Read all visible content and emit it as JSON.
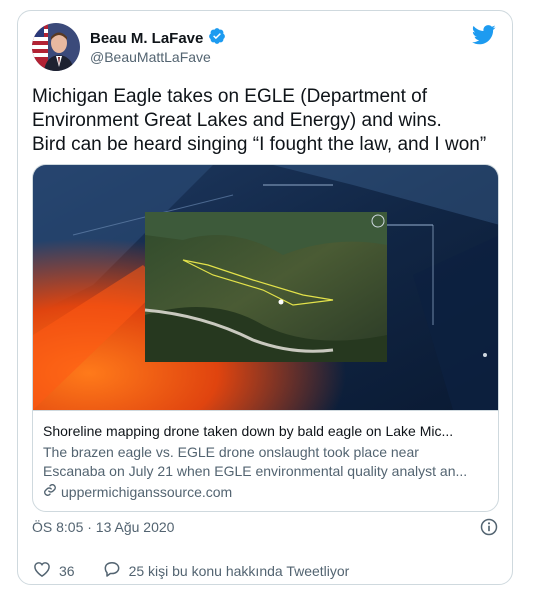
{
  "author": {
    "name": "Beau M. LaFave",
    "handle": "@BeauMattLaFave"
  },
  "tweet": {
    "lines": [
      "Michigan Eagle takes on EGLE (Department of",
      "Environment Great Lakes and Energy) and wins.",
      "Bird can be heard singing “I fought the law, and I won”"
    ]
  },
  "link_card": {
    "title": "Shoreline mapping drone taken down by bald eagle on Lake Mic...",
    "description_lines": [
      "The brazen eagle vs. EGLE drone onslaught took place near",
      "Escanaba on July 21 when EGLE environmental quality analyst an..."
    ],
    "url": "uppermichiganssource.com"
  },
  "timestamp": "ÖS 8:05 · 13 Ağu 2020",
  "actions": {
    "likes": "36",
    "reply_text": "25 kişi bu konu hakkında Tweetliyor"
  },
  "colors": {
    "twitter_blue": "#1d9bf0",
    "text": "#0f1419",
    "secondary": "#536471",
    "border": "#cfd9de"
  },
  "icons": [
    "twitter-bird-icon",
    "verified-badge-icon",
    "link-icon",
    "info-icon",
    "heart-icon",
    "reply-icon"
  ]
}
